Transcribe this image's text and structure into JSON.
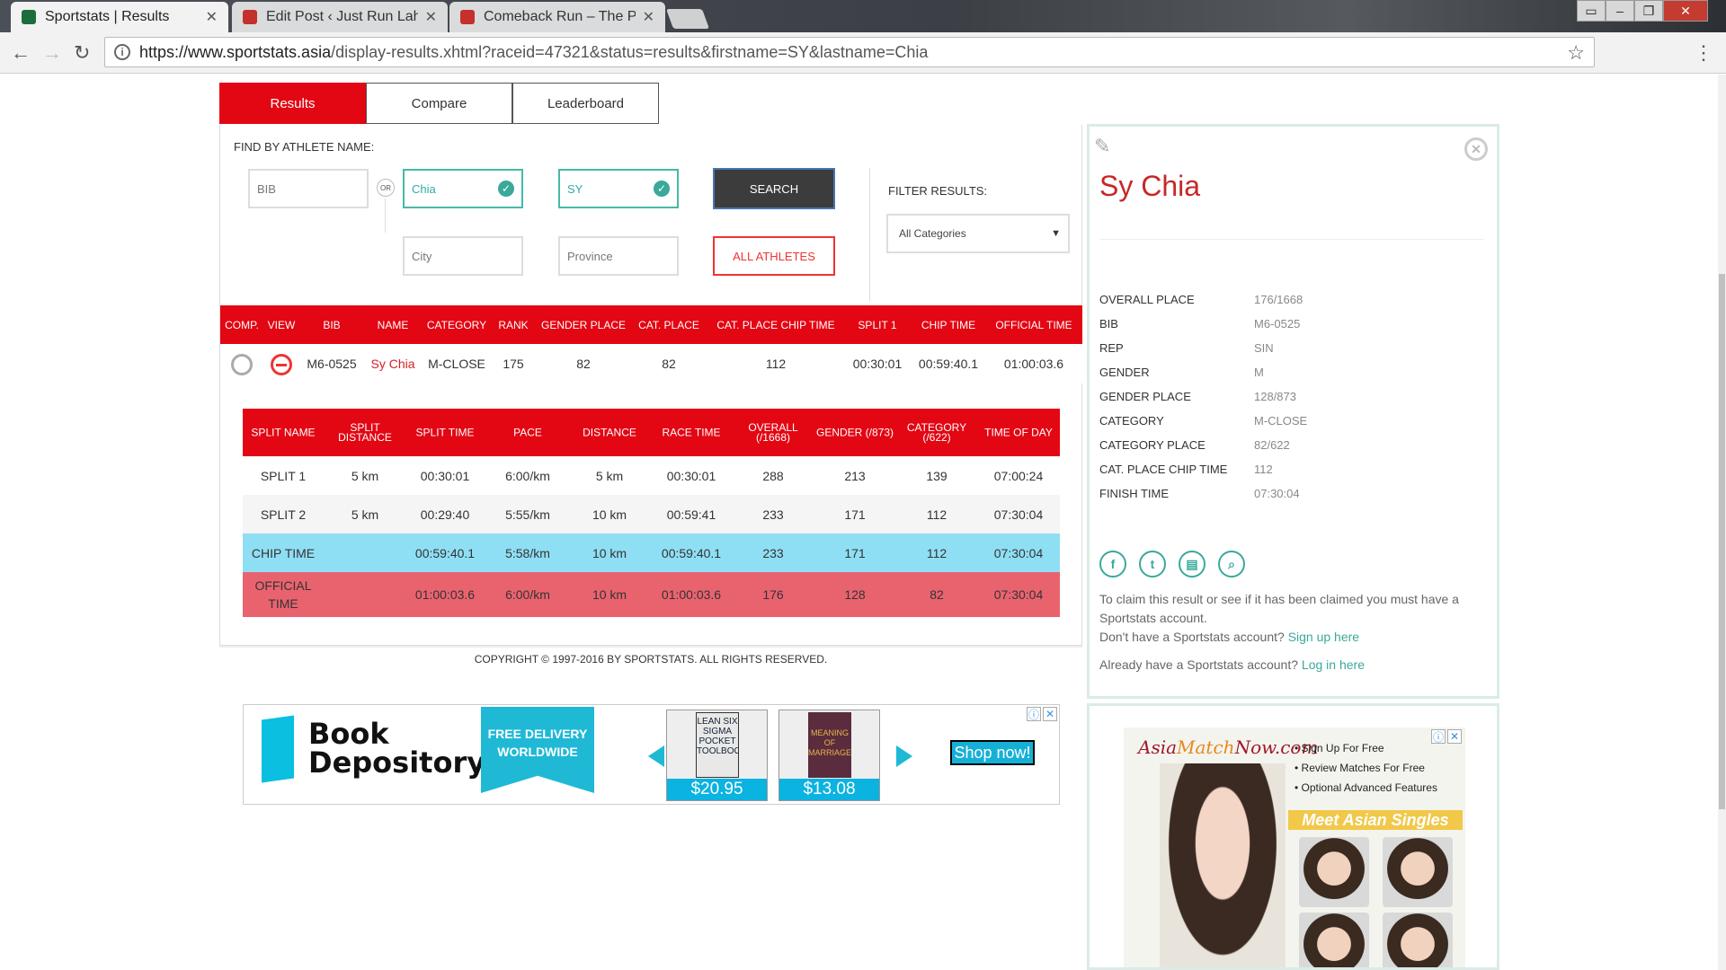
{
  "browser": {
    "tabs": [
      {
        "title": "Sportstats | Results",
        "active": true,
        "favicon_color": "#1b6e3c"
      },
      {
        "title": "Edit Post ‹ Just Run Lah! — W",
        "active": false,
        "favicon_color": "#c4302b"
      },
      {
        "title": "Comeback Run – The Personal",
        "active": false,
        "favicon_color": "#c4302b"
      }
    ],
    "url_host": "https://www.sportstats.asia",
    "url_path": "/display-results.xhtml?raceid=47321&status=results&firstname=SY&lastname=Chia",
    "icons": [
      "back-icon",
      "forward-icon",
      "reload-icon",
      "info-icon",
      "star-icon",
      "menu-icon"
    ]
  },
  "nav_tabs": {
    "results": "Results",
    "compare": "Compare",
    "leaderboard": "Leaderboard"
  },
  "search": {
    "find_label": "FIND BY ATHLETE NAME:",
    "bib_placeholder": "BIB",
    "or_label": "OR",
    "lastname_value": "Chia",
    "firstname_value": "SY",
    "city_placeholder": "City",
    "province_placeholder": "Province",
    "search_button": "SEARCH",
    "all_athletes_button": "ALL ATHLETES",
    "filter_label": "FILTER RESULTS:",
    "category_selected": "All Categories"
  },
  "results_table": {
    "headers": [
      "COMP.",
      "VIEW",
      "BIB",
      "NAME",
      "CATEGORY",
      "RANK",
      "GENDER PLACE",
      "CAT. PLACE",
      "CAT. PLACE CHIP TIME",
      "SPLIT 1",
      "CHIP TIME",
      "OFFICIAL TIME"
    ],
    "row": {
      "bib": "M6-0525",
      "name": "Sy Chia",
      "category": "M-CLOSE",
      "rank": "175",
      "gender_place": "82",
      "cat_place": "82",
      "cat_place_chip_time": "112",
      "split1": "00:30:01",
      "chip_time": "00:59:40.1",
      "official_time": "01:00:03.6"
    }
  },
  "splits_table": {
    "headers": [
      "SPLIT NAME",
      "SPLIT DISTANCE",
      "SPLIT TIME",
      "PACE",
      "DISTANCE",
      "RACE TIME",
      "OVERALL (/1668)",
      "GENDER (/873)",
      "CATEGORY (/622)",
      "TIME OF DAY"
    ],
    "header_lines": [
      [
        "SPLIT NAME"
      ],
      [
        "SPLIT",
        "DISTANCE"
      ],
      [
        "SPLIT TIME"
      ],
      [
        "PACE"
      ],
      [
        "DISTANCE"
      ],
      [
        "RACE TIME"
      ],
      [
        "OVERALL",
        "(/1668)"
      ],
      [
        "GENDER (/873)"
      ],
      [
        "CATEGORY",
        "(/622)"
      ],
      [
        "TIME OF DAY"
      ]
    ],
    "rows": [
      {
        "cells": [
          "SPLIT 1",
          "5 km",
          "00:30:01",
          "6:00/km",
          "5 km",
          "00:30:01",
          "288",
          "213",
          "139",
          "07:00:24"
        ],
        "style": "odd"
      },
      {
        "cells": [
          "SPLIT 2",
          "5 km",
          "00:29:40",
          "5:55/km",
          "10 km",
          "00:59:41",
          "233",
          "171",
          "112",
          "07:30:04"
        ],
        "style": "even"
      },
      {
        "cells": [
          "CHIP TIME",
          "",
          "00:59:40.1",
          "5:58/km",
          "10 km",
          "00:59:40.1",
          "233",
          "171",
          "112",
          "07:30:04"
        ],
        "style": "chip"
      },
      {
        "cells": [
          "OFFICIAL TIME",
          "",
          "01:00:03.6",
          "6:00/km",
          "10 km",
          "01:00:03.6",
          "176",
          "128",
          "82",
          "07:30:04"
        ],
        "style": "off"
      }
    ]
  },
  "copyright": "COPYRIGHT © 1997-2016 BY SPORTSTATS. ALL RIGHTS RESERVED.",
  "ad_book": {
    "brand_line1": "Book",
    "brand_line2": "Depository",
    "delivery_line1": "FREE DELIVERY",
    "delivery_line2": "WORLDWIDE",
    "book1_title": "LEAN SIX SIGMA POCKET TOOLBOOK",
    "book1_price": "$20.95",
    "book2_title": "MEANING OF MARRIAGE",
    "book2_price": "$13.08",
    "shop_button": "Shop now!"
  },
  "athlete": {
    "name": "Sy Chia",
    "details": [
      {
        "label": "OVERALL PLACE",
        "value": "176/1668"
      },
      {
        "label": "BIB",
        "value": "M6-0525"
      },
      {
        "label": "REP",
        "value": "SIN"
      },
      {
        "label": "GENDER",
        "value": "M"
      },
      {
        "label": "GENDER PLACE",
        "value": "128/873"
      },
      {
        "label": "CATEGORY",
        "value": "M-CLOSE"
      },
      {
        "label": "CATEGORY PLACE",
        "value": "82/622"
      },
      {
        "label": "CAT. PLACE CHIP TIME",
        "value": "112"
      },
      {
        "label": "FINISH TIME",
        "value": "07:30:04"
      }
    ],
    "socials": [
      "facebook-icon",
      "twitter-icon",
      "document-icon",
      "search-icon"
    ],
    "claim_text": "To claim this result or see if it has been claimed you must have a Sportstats account.",
    "signup_prompt": "Don't have a Sportstats account?",
    "signup_link": "Sign up here",
    "login_prompt": "Already have a Sportstats account?",
    "login_link": "Log in here"
  },
  "ad_dating": {
    "logo_part1": "Asia",
    "logo_part2": "Match",
    "logo_part3": "Now.com",
    "bullets": [
      "Sign Up For Free",
      "Review Matches For Free",
      "Optional Advanced Features"
    ],
    "banner": "Meet Asian Singles"
  },
  "colors": {
    "brand_red": "#e30613",
    "teal": "#3aa99a",
    "chip_row": "#8fdff4",
    "official_row": "#e9636f"
  }
}
